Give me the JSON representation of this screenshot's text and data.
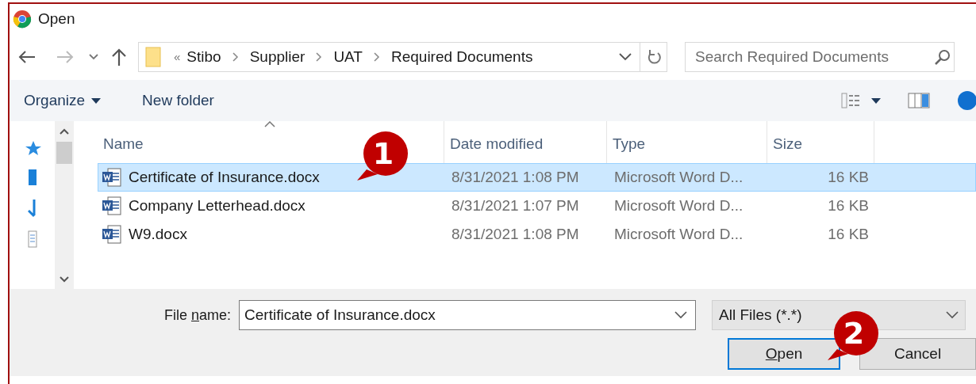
{
  "window": {
    "title": "Open"
  },
  "address_bar": {
    "overflow": "«",
    "crumbs": [
      "Stibo",
      "Supplier",
      "UAT",
      "Required Documents"
    ]
  },
  "search": {
    "placeholder": "Search Required Documents"
  },
  "toolbar": {
    "organize": "Organize",
    "new_folder": "New folder"
  },
  "table": {
    "columns": [
      "Name",
      "Date modified",
      "Type",
      "Size"
    ],
    "rows": [
      {
        "name": "Certificate of Insurance.docx",
        "date": "8/31/2021 1:08 PM",
        "type": "Microsoft Word D...",
        "size": "16 KB",
        "selected": true
      },
      {
        "name": "Company Letterhead.docx",
        "date": "8/31/2021 1:07 PM",
        "type": "Microsoft Word D...",
        "size": "16 KB",
        "selected": false
      },
      {
        "name": "W9.docx",
        "date": "8/31/2021 1:08 PM",
        "type": "Microsoft Word D...",
        "size": "16 KB",
        "selected": false
      }
    ]
  },
  "file_name": {
    "label": [
      {
        "text": "File ",
        "underline": false
      },
      {
        "text": "n",
        "underline": true
      },
      {
        "text": "ame:",
        "underline": false
      }
    ],
    "value": "Certificate of Insurance.docx"
  },
  "file_type": {
    "value": "All Files (*.*)"
  },
  "buttons": [
    {
      "label": [
        {
          "text": "O",
          "underline": true
        },
        {
          "text": "pen",
          "underline": false
        }
      ],
      "default": true
    },
    {
      "label": [
        {
          "text": "Cancel",
          "underline": false
        }
      ],
      "default": false
    }
  ],
  "callouts": [
    {
      "label": "1"
    },
    {
      "label": "2"
    }
  ]
}
